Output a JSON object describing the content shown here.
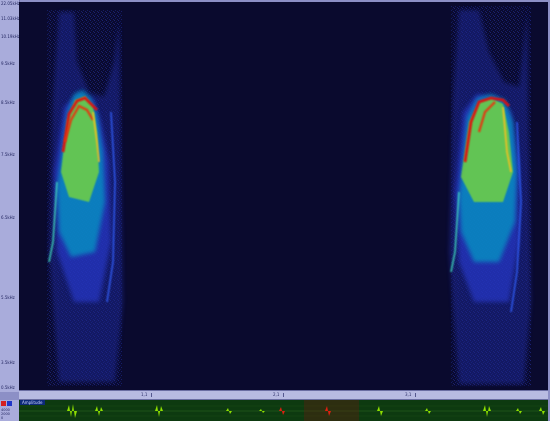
{
  "freq_axis": {
    "labels": [
      "22.05kHz",
      "11.03kHz",
      "10.19kHz",
      "9.5kHz",
      "8.5kHz",
      "7.5kHz",
      "6.5kHz",
      "5.5kHz",
      "3.5kHz",
      "0.5kHz"
    ]
  },
  "time_ruler": {
    "labels": [
      "1,1",
      "2,1",
      "3,1"
    ]
  },
  "amplitude_panel": {
    "values": [
      "4000",
      "2000",
      "0"
    ]
  },
  "waveform": {
    "label": "Amplitude"
  },
  "colors": {
    "background": "#0a0a2e",
    "low": "#2030c0",
    "mid": "#00d0d0",
    "high": "#d0e000",
    "peak": "#e01010",
    "waveform_bg": "#0d3a10",
    "waveform_line": "#8fe000"
  }
}
